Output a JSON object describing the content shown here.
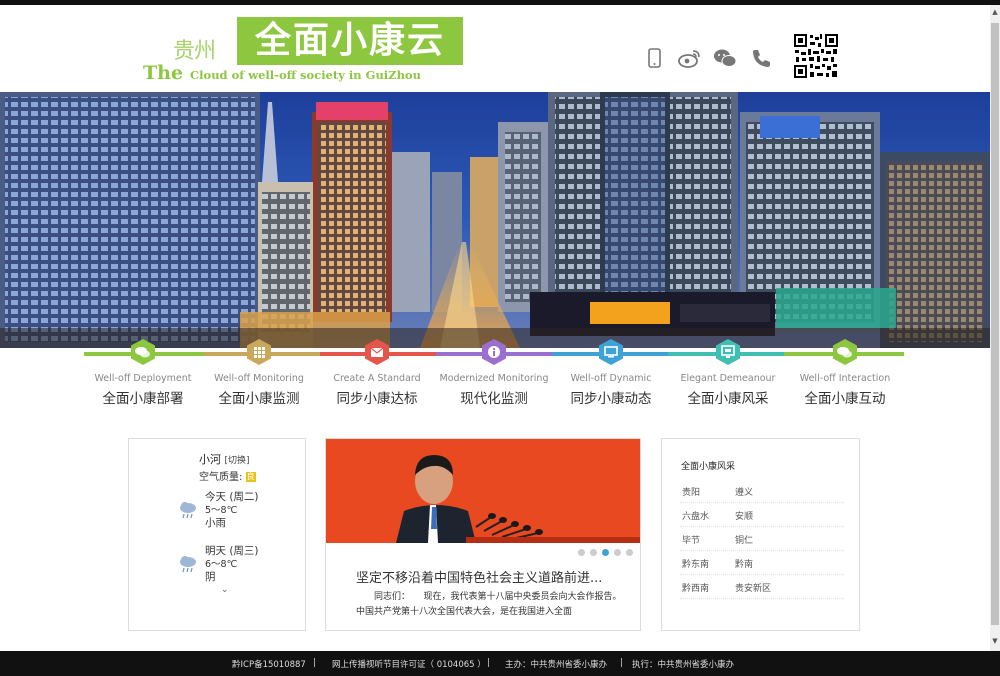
{
  "header": {
    "logo_gz": "贵州",
    "logo_main": "全面小康云",
    "logo_the": "The",
    "logo_sub": "Cloud of well-off society in GuiZhou",
    "icons": [
      "phone-icon",
      "weibo-icon",
      "wechat-icon",
      "telephone-icon"
    ],
    "qr": "qr-code"
  },
  "nav": {
    "items": [
      {
        "en": "Well-off Deployment",
        "cn": "全面小康部署",
        "color": "#8dc63f"
      },
      {
        "en": "Well-off Monitoring",
        "cn": "全面小康监测",
        "color": "#c9a85c"
      },
      {
        "en": "Create A Standard",
        "cn": "同步小康达标",
        "color": "#e4554c"
      },
      {
        "en": "Modernized Monitoring",
        "cn": "现代化监测",
        "color": "#9b6fcf"
      },
      {
        "en": "Well-off Dynamic",
        "cn": "同步小康动态",
        "color": "#3ea2d6"
      },
      {
        "en": "Elegant Demeanour",
        "cn": "全面小康风采",
        "color": "#3fbfb2"
      },
      {
        "en": "Well-off Interaction",
        "cn": "全面小康互动",
        "color": "#8dc63f"
      }
    ]
  },
  "weather": {
    "city": "小河",
    "switch_label": "[切换]",
    "air_quality_label": "空气质量:",
    "air_quality_badge": "良",
    "days": [
      {
        "day": "今天 (周二)",
        "temp": "5～8℃",
        "desc": "小雨"
      },
      {
        "day": "明天 (周三)",
        "temp": "6～8℃",
        "desc": "阴"
      }
    ],
    "more": "⌄"
  },
  "news": {
    "title": "坚定不移沿着中国特色社会主义道路前进...",
    "body": "同志们：　　现在，我代表第十八届中央委员会向大会作报告。　　中国共产党第十八次全国代表大会，是在我国进入全面",
    "dots": 5,
    "active_dot": 3
  },
  "cities": {
    "title": "全面小康风采",
    "rows": [
      [
        "贵阳",
        "遵义"
      ],
      [
        "六盘水",
        "安顺"
      ],
      [
        "毕节",
        "铜仁"
      ],
      [
        "黔东南",
        "黔南"
      ],
      [
        "黔西南",
        "贵安新区"
      ]
    ]
  },
  "footer": {
    "icp": "黔ICP备15010887",
    "license": "网上传播视听节目许可证（ 0104065 ）",
    "host": "主办：中共贵州省委小康办",
    "exec": "执行：中共贵州省委小康办",
    "sep": "|"
  }
}
